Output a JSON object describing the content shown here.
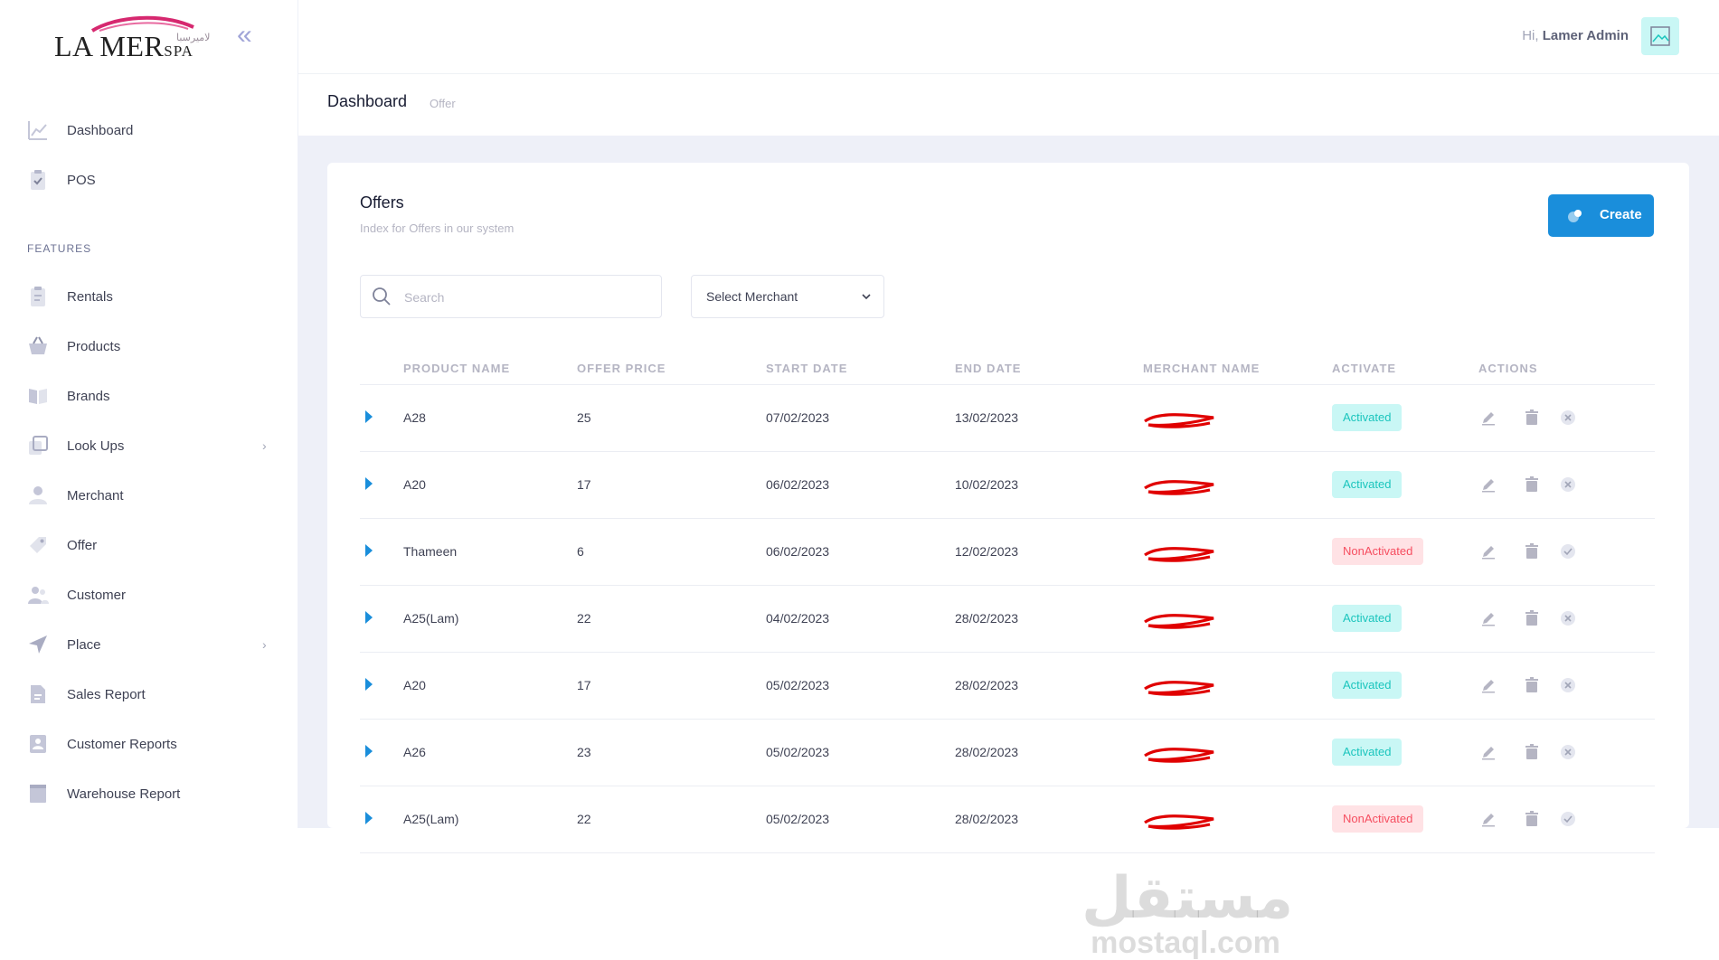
{
  "brand": {
    "name": "LA MER",
    "suffix": "SPA",
    "arabic": "لاميرسبا"
  },
  "sidebar": {
    "items": [
      {
        "label": "Dashboard",
        "icon": "chart-line-icon"
      },
      {
        "label": "POS",
        "icon": "clipboard-check-icon"
      }
    ],
    "section_title": "FEATURES",
    "features": [
      {
        "label": "Rentals",
        "icon": "clipboard-icon"
      },
      {
        "label": "Products",
        "icon": "basket-icon"
      },
      {
        "label": "Brands",
        "icon": "book-icon"
      },
      {
        "label": "Look Ups",
        "icon": "layers-icon",
        "has_submenu": true
      },
      {
        "label": "Merchant",
        "icon": "user-icon"
      },
      {
        "label": "Offer",
        "icon": "tag-icon"
      },
      {
        "label": "Customer",
        "icon": "users-icon"
      },
      {
        "label": "Place",
        "icon": "navigation-icon",
        "has_submenu": true
      },
      {
        "label": "Sales Report",
        "icon": "file-icon"
      },
      {
        "label": "Customer Reports",
        "icon": "contact-icon"
      },
      {
        "label": "Warehouse Report",
        "icon": "box-icon"
      }
    ]
  },
  "header": {
    "greeting": "Hi,",
    "user_name": "Lamer Admin"
  },
  "breadcrumb": {
    "title": "Dashboard",
    "sub": "Offer"
  },
  "card": {
    "title": "Offers",
    "description": "Index for Offers in our system",
    "create_label": "Create",
    "search_placeholder": "Search",
    "merchant_select": "Select Merchant"
  },
  "table": {
    "headers": [
      "PRODUCT NAME",
      "OFFER PRICE",
      "START DATE",
      "END DATE",
      "MERCHANT NAME",
      "ACTIVATE",
      "ACTIONS"
    ],
    "rows": [
      {
        "product": "A28",
        "price": "25",
        "start": "07/02/2023",
        "end": "13/02/2023",
        "status": "Activated",
        "active": true
      },
      {
        "product": "A20",
        "price": "17",
        "start": "06/02/2023",
        "end": "10/02/2023",
        "status": "Activated",
        "active": true
      },
      {
        "product": "Thameen",
        "price": "6",
        "start": "06/02/2023",
        "end": "12/02/2023",
        "status": "NonActivated",
        "active": false
      },
      {
        "product": "A25(Lam)",
        "price": "22",
        "start": "04/02/2023",
        "end": "28/02/2023",
        "status": "Activated",
        "active": true
      },
      {
        "product": "A20",
        "price": "17",
        "start": "05/02/2023",
        "end": "28/02/2023",
        "status": "Activated",
        "active": true
      },
      {
        "product": "A26",
        "price": "23",
        "start": "05/02/2023",
        "end": "28/02/2023",
        "status": "Activated",
        "active": true
      },
      {
        "product": "A25(Lam)",
        "price": "22",
        "start": "05/02/2023",
        "end": "28/02/2023",
        "status": "NonActivated",
        "active": false
      }
    ]
  },
  "watermark": {
    "arabic": "مستقل",
    "latin": "mostaql.com"
  },
  "colors": {
    "accent": "#1a8edb",
    "active_bg": "#c9f7f5",
    "active_text": "#1bc5bd",
    "inactive_bg": "#ffe2e5",
    "inactive_text": "#f64e60",
    "redaction": "#e00000"
  }
}
